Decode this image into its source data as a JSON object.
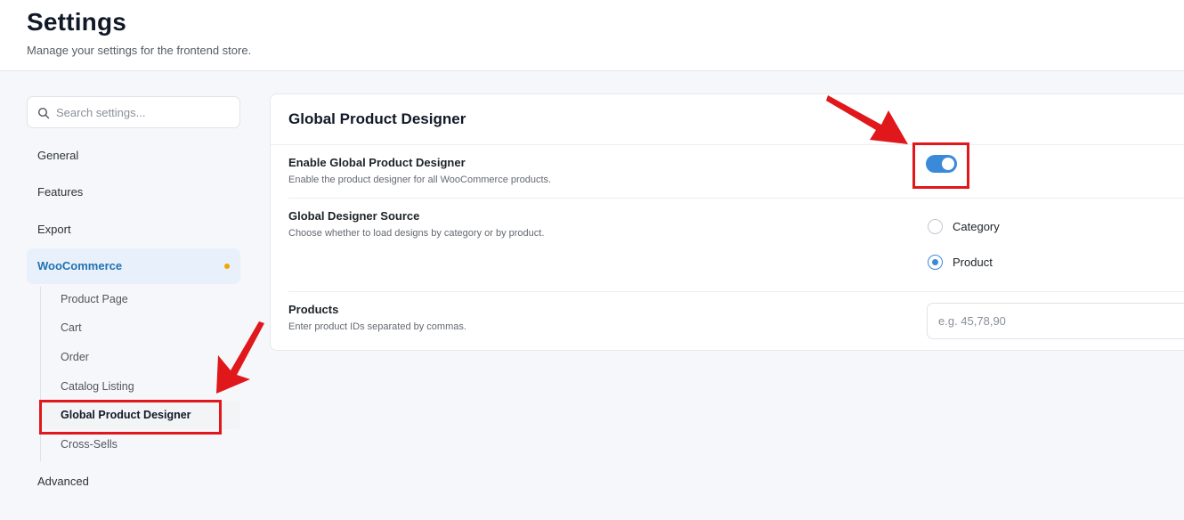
{
  "header": {
    "title": "Settings",
    "subtitle": "Manage your settings for the frontend store."
  },
  "search": {
    "placeholder": "Search settings...",
    "value": ""
  },
  "sidebar": {
    "items": [
      {
        "label": "General"
      },
      {
        "label": "Features"
      },
      {
        "label": "Export"
      },
      {
        "label": "WooCommerce",
        "active": true,
        "has_dot": true
      },
      {
        "label": "Advanced"
      }
    ],
    "woocommerce_subitems": [
      {
        "label": "Product Page"
      },
      {
        "label": "Cart"
      },
      {
        "label": "Order"
      },
      {
        "label": "Catalog Listing"
      },
      {
        "label": "Global Product Designer",
        "active": true
      },
      {
        "label": "Cross-Sells"
      }
    ]
  },
  "card": {
    "title": "Global Product Designer",
    "rows": [
      {
        "label": "Enable Global Product Designer",
        "description": "Enable the product designer for all WooCommerce products.",
        "toggle_on": true
      },
      {
        "label": "Global Designer Source",
        "description": "Choose whether to load designs by category or by product.",
        "options": [
          {
            "label": "Category",
            "checked": false
          },
          {
            "label": "Product",
            "checked": true
          }
        ]
      },
      {
        "label": "Products",
        "description": "Enter product IDs separated by commas.",
        "placeholder": "e.g. 45,78,90",
        "value": ""
      }
    ]
  },
  "colors": {
    "accent": "#3b8ad9",
    "active_nav_bg": "#e8f1fb",
    "active_nav_text": "#2271b1",
    "dot": "#f0a500",
    "annotation_red": "#e0171b"
  }
}
